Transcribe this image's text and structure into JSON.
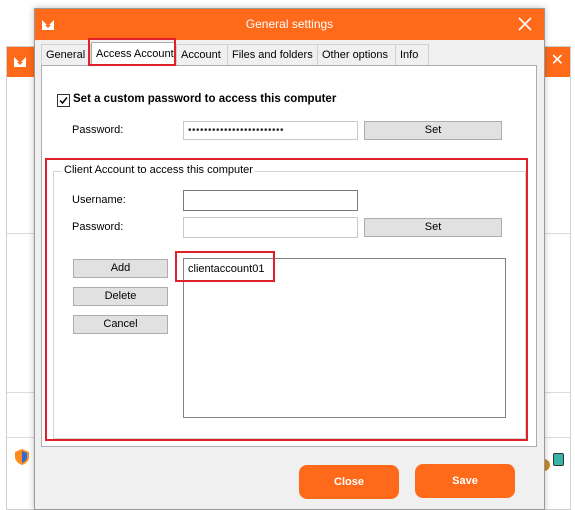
{
  "dialog": {
    "title": "General settings",
    "close_icon": "close-icon",
    "accent_color": "#ff6a1a",
    "highlight_color": "#e0202a"
  },
  "tabs": [
    {
      "label": "General"
    },
    {
      "label": "Access Account",
      "active": true
    },
    {
      "label": "Account"
    },
    {
      "label": "Files and folders"
    },
    {
      "label": "Other options"
    },
    {
      "label": "Info"
    }
  ],
  "custom_password": {
    "checkbox_label": "Set a custom password to access this computer",
    "checked": true,
    "password_label": "Password:",
    "password_value": "••••••••••••••••••••••••",
    "set_label": "Set"
  },
  "client_account": {
    "group_title": "Client Account to access this computer",
    "username_label": "Username:",
    "username_value": "",
    "password_label": "Password:",
    "password_value": "",
    "set_label": "Set",
    "add_label": "Add",
    "delete_label": "Delete",
    "cancel_label": "Cancel",
    "accounts": [
      "clientaccount01"
    ]
  },
  "footer": {
    "close_label": "Close",
    "save_label": "Save"
  }
}
